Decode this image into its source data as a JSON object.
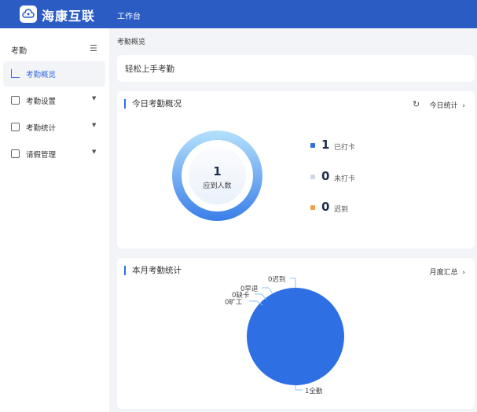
{
  "header": {
    "brand": "海康互联",
    "nav": "工作台"
  },
  "sidebar": {
    "title": "考勤",
    "items": [
      {
        "label": "考勤概览",
        "active": true
      },
      {
        "label": "考勤设置"
      },
      {
        "label": "考勤统计"
      },
      {
        "label": "请假管理"
      }
    ]
  },
  "breadcrumb": "考勤概览",
  "quickstart": "轻松上手考勤",
  "today": {
    "title": "今日考勤概况",
    "link": "今日统计",
    "total": "1",
    "total_label": "应到人数",
    "legend": [
      {
        "value": "1",
        "label": "已打卡",
        "color": "#2f6fe4"
      },
      {
        "value": "0",
        "label": "未打卡",
        "color": "#cfd6e3"
      },
      {
        "value": "0",
        "label": "迟到",
        "color": "#f7a04a"
      }
    ]
  },
  "monthly": {
    "title": "本月考勤统计",
    "link": "月度汇总"
  },
  "chart_data": {
    "type": "pie",
    "categories": [
      "迟到",
      "早退",
      "缺卡",
      "旷工",
      "全勤"
    ],
    "values": [
      0,
      0,
      0,
      0,
      1
    ],
    "labels": [
      "0迟到",
      "0早退",
      "0缺卡",
      "0旷工",
      "1全勤"
    ],
    "color": "#2f6fe4"
  }
}
